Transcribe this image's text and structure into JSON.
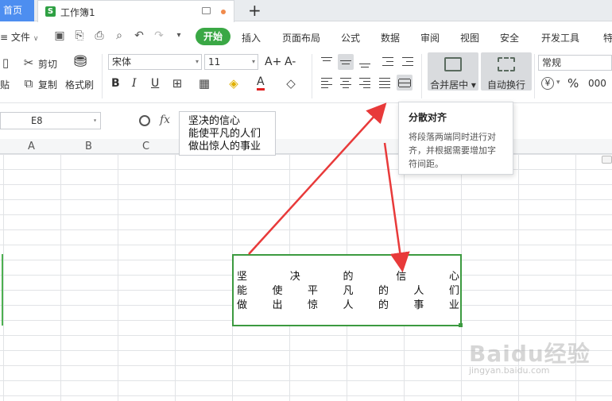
{
  "tabs": {
    "home": "首页",
    "workbook_icon": "S",
    "workbook": "工作簿1",
    "add": "+"
  },
  "menu": {
    "file": "文件",
    "items": [
      "开始",
      "插入",
      "页面布局",
      "公式",
      "数据",
      "审阅",
      "视图",
      "安全",
      "开发工具",
      "特"
    ]
  },
  "ribbon": {
    "cut": "剪切",
    "copy": "复制",
    "paste": "贴",
    "format_painter": "格式刷",
    "font_name": "宋体",
    "font_size": "11",
    "grow_font": "A+",
    "shrink_font": "A-",
    "bold": "B",
    "italic": "I",
    "underline": "U",
    "font_color": "A",
    "merge_center": "合并居中",
    "wrap_text": "自动换行",
    "number_format": "常规",
    "currency": "¥",
    "percent": "%",
    "thousands": "000"
  },
  "formula_bar": {
    "name_box": "E8",
    "fx": "fx",
    "content_lines": [
      "坚决的信心",
      "能使平凡的人们",
      "做出惊人的事业"
    ]
  },
  "columns": [
    "A",
    "B",
    "C"
  ],
  "cell": {
    "rows": [
      [
        "坚",
        "决",
        "的",
        "信",
        "心"
      ],
      [
        "能",
        "使",
        "平",
        "凡",
        "的",
        "人",
        "们"
      ],
      [
        "做",
        "出",
        "惊",
        "人",
        "的",
        "事",
        "业"
      ]
    ]
  },
  "tooltip": {
    "title": "分散对齐",
    "body": "将段落两端同时进行对齐，并根据需要增加字符间距。"
  },
  "watermark": {
    "brand": "Baidu经验",
    "url": "jingyan.baidu.com"
  },
  "colors": {
    "accent_green": "#3aa845",
    "selection_green": "#3c9a40",
    "arrow_red": "#e83a3a",
    "home_tab_blue": "#4d8ef0"
  }
}
